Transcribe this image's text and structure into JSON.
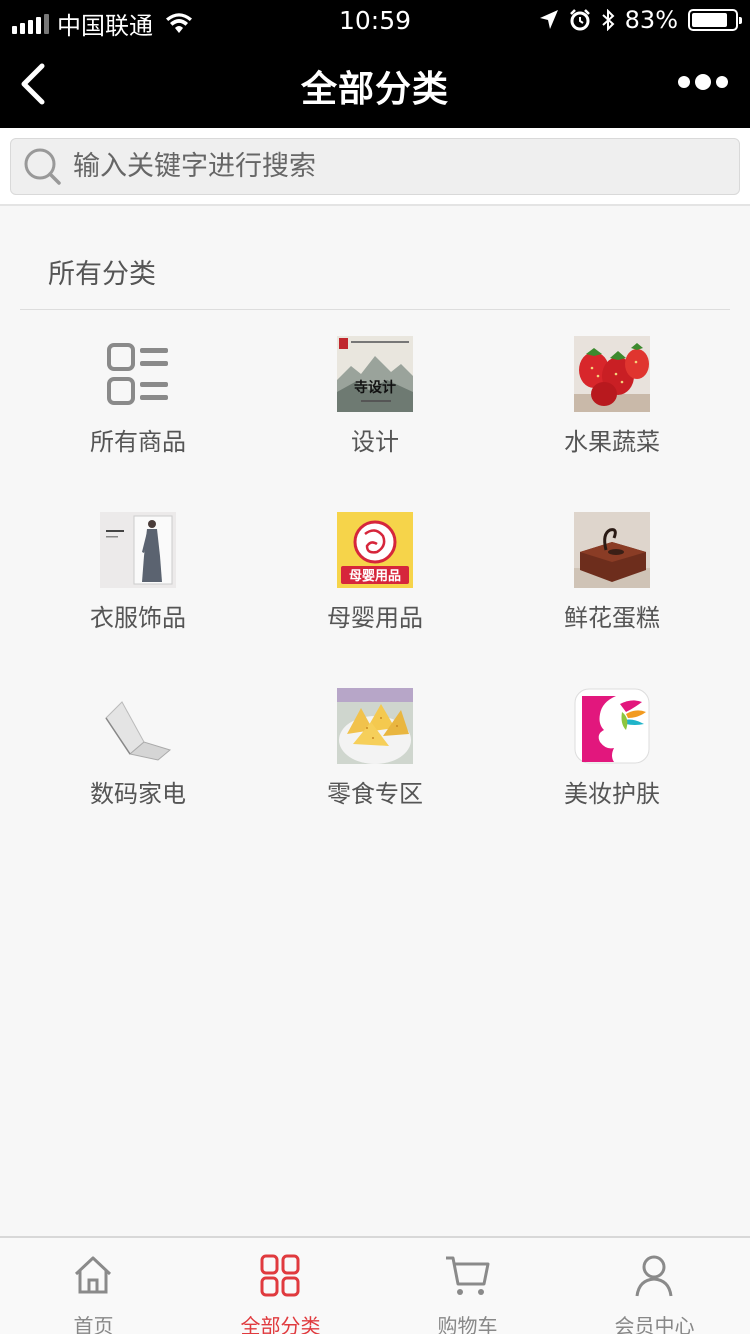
{
  "status_bar": {
    "carrier": "中国联通",
    "time": "10:59",
    "battery": "83%",
    "battery_level": 0.83
  },
  "nav": {
    "title": "全部分类",
    "back_icon": "chevron-left-icon",
    "more_icon": "more-dots-icon"
  },
  "search": {
    "placeholder": "输入关键字进行搜索",
    "value": "",
    "icon": "search-icon"
  },
  "section": {
    "title": "所有分类"
  },
  "categories": [
    {
      "label": "所有商品",
      "icon": "list-grid-icon"
    },
    {
      "label": "设计",
      "icon": "design-thumbnail"
    },
    {
      "label": "水果蔬菜",
      "icon": "strawberry-thumbnail"
    },
    {
      "label": "衣服饰品",
      "icon": "clothing-thumbnail"
    },
    {
      "label": "母婴用品",
      "icon": "baby-products-thumbnail"
    },
    {
      "label": "鲜花蛋糕",
      "icon": "cake-thumbnail"
    },
    {
      "label": "数码家电",
      "icon": "laptop-thumbnail"
    },
    {
      "label": "零食专区",
      "icon": "snack-thumbnail"
    },
    {
      "label": "美妆护肤",
      "icon": "cosmetics-logo-thumbnail"
    }
  ],
  "design_thumb_text": "寺设计",
  "baby_thumb_text": "母婴用品",
  "tabbar": {
    "items": [
      {
        "label": "首页",
        "icon": "home-icon",
        "active": false
      },
      {
        "label": "全部分类",
        "icon": "category-grid-icon",
        "active": true
      },
      {
        "label": "购物车",
        "icon": "cart-icon",
        "active": false
      },
      {
        "label": "会员中心",
        "icon": "user-icon",
        "active": false
      }
    ]
  },
  "colors": {
    "accent": "#e03a3e",
    "header_bg": "#000000",
    "page_bg": "#f7f7f7"
  }
}
